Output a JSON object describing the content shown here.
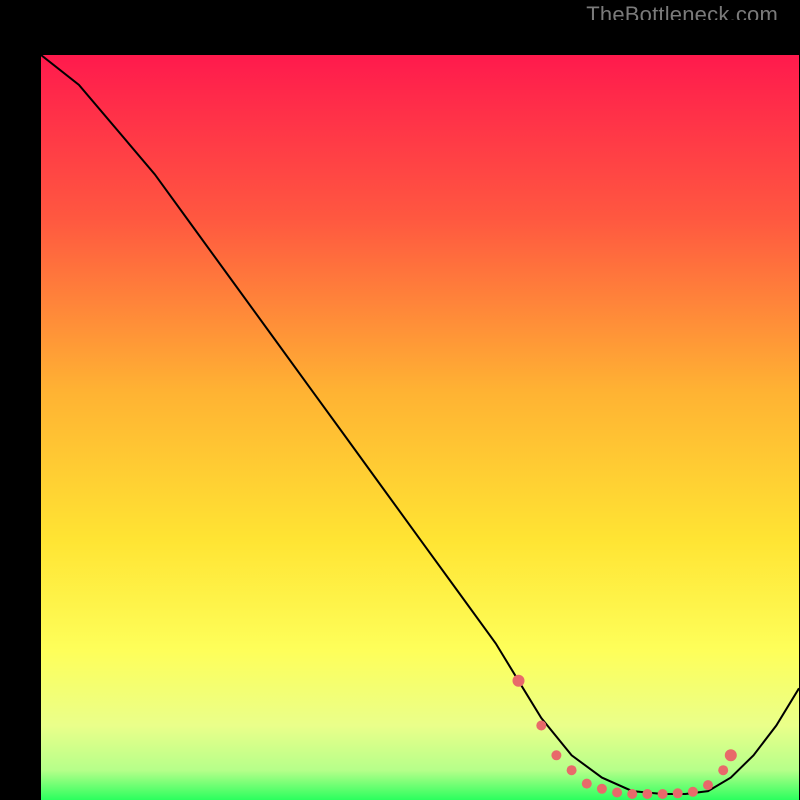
{
  "watermark": "TheBottleneck.com",
  "chart_data": {
    "type": "line",
    "title": "",
    "xlabel": "",
    "ylabel": "",
    "xlim": [
      0,
      100
    ],
    "ylim": [
      0,
      100
    ],
    "background_gradient": {
      "top": "#ff1a4d",
      "mid_upper": "#ff7a33",
      "mid": "#ffd633",
      "mid_lower": "#ffff66",
      "lower": "#e6ffb3",
      "bottom": "#33ff66"
    },
    "series": [
      {
        "name": "bottleneck-curve",
        "x": [
          0,
          5,
          10,
          15,
          20,
          25,
          30,
          35,
          40,
          45,
          50,
          55,
          60,
          63,
          66,
          70,
          74,
          78,
          82,
          85,
          88,
          91,
          94,
          97,
          100
        ],
        "y": [
          100,
          96,
          90,
          84,
          77,
          70,
          63,
          56,
          49,
          42,
          35,
          28,
          21,
          16,
          11,
          6,
          3,
          1.2,
          0.8,
          0.8,
          1.2,
          3,
          6,
          10,
          15
        ]
      }
    ],
    "points": {
      "name": "highlight-dots",
      "color": "#e86a6a",
      "x": [
        63,
        66,
        68,
        70,
        72,
        74,
        76,
        78,
        80,
        82,
        84,
        86,
        88,
        90,
        91
      ],
      "y": [
        16,
        10,
        6,
        4,
        2.2,
        1.5,
        1.0,
        0.8,
        0.8,
        0.8,
        0.9,
        1.1,
        2.0,
        4,
        6
      ]
    }
  }
}
